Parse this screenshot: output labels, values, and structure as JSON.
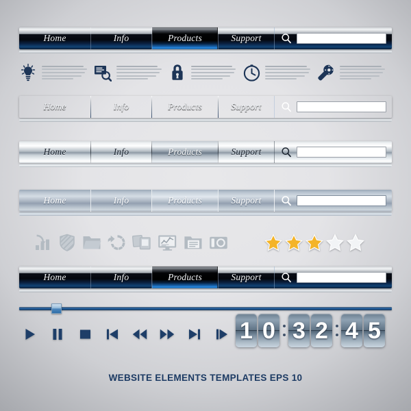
{
  "page": {
    "background_color": "#e7e7e9",
    "vignette_edge_color": "#a7a9ae",
    "caption": "WEBSITE ELEMENTS TEMPLATES EPS 10",
    "caption_color": "#1c3a63"
  },
  "navbars": [
    {
      "id": "navbar-dark-1",
      "style": "glossy-black-blue",
      "tabs": [
        {
          "label": "Home",
          "active": false
        },
        {
          "label": "Info",
          "active": false
        },
        {
          "label": "Products",
          "active": true
        },
        {
          "label": "Support",
          "active": false
        }
      ],
      "search": {
        "icon": "search-icon",
        "value": "",
        "placeholder": ""
      },
      "accent_color": "#2f93e8",
      "has_underline": true
    },
    {
      "id": "navbar-dark-2",
      "style": "chrome-top-black-blue",
      "tabs": [
        {
          "label": "Home",
          "active": false
        },
        {
          "label": "Info",
          "active": false
        },
        {
          "label": "Products",
          "active": true
        },
        {
          "label": "Support",
          "active": false
        }
      ],
      "search": {
        "icon": "search-icon",
        "value": "",
        "placeholder": ""
      },
      "accent_color": "#3aa0ef",
      "has_underline": true
    },
    {
      "id": "navbar-silver-3",
      "style": "light-silver-chrome",
      "tabs": [
        {
          "label": "Home",
          "active": false
        },
        {
          "label": "Info",
          "active": false
        },
        {
          "label": "Products",
          "active": true
        },
        {
          "label": "Support",
          "active": false
        }
      ],
      "search": {
        "icon": "search-icon",
        "value": "",
        "placeholder": ""
      },
      "accent_color": "#8e9aa5",
      "has_underline": true
    },
    {
      "id": "navbar-bluegrey-4",
      "style": "soft-blue-grey",
      "tabs": [
        {
          "label": "Home",
          "active": false
        },
        {
          "label": "Info",
          "active": false
        },
        {
          "label": "Products",
          "active": true
        },
        {
          "label": "Support",
          "active": false
        }
      ],
      "search": {
        "icon": "search-icon",
        "value": "",
        "placeholder": ""
      },
      "accent_color": "#aab5c2",
      "has_underline": true
    },
    {
      "id": "navbar-dark-5",
      "style": "glossy-black-blue",
      "tabs": [
        {
          "label": "Home",
          "active": false
        },
        {
          "label": "Info",
          "active": false
        },
        {
          "label": "Products",
          "active": true
        },
        {
          "label": "Support",
          "active": false
        }
      ],
      "search": {
        "icon": "search-icon",
        "value": "",
        "placeholder": ""
      },
      "accent_color": "#2f93e8",
      "has_underline": true
    }
  ],
  "feature_row": {
    "items": [
      {
        "icon": "lightbulb-icon",
        "text_placeholder_lines": 5
      },
      {
        "icon": "document-search-icon",
        "text_placeholder_lines": 5
      },
      {
        "icon": "lock-icon",
        "text_placeholder_lines": 5
      },
      {
        "icon": "clock-icon",
        "text_placeholder_lines": 5
      },
      {
        "icon": "wrench-gear-icon",
        "text_placeholder_lines": 5
      }
    ],
    "icon_color": "#1d3557",
    "line_color": "#b9bec4"
  },
  "grey_icon_strip": {
    "icon_color": "#b3bbc2",
    "icons": [
      "bar-chart-arrow-icon",
      "shield-striped-icon",
      "folder-icon",
      "pie-chart-refresh-icon",
      "photos-stack-icon",
      "monitor-line-chart-icon",
      "folder-documents-icon",
      "camera-icon"
    ]
  },
  "rating": {
    "label": "star-rating",
    "value": 3,
    "max": 5,
    "filled_color": "#f4b428",
    "empty_color": "#f2f4f6"
  },
  "player": {
    "slider": {
      "value_percent": 10,
      "track_color": "#2f6fae",
      "handle_color": "#9dc0dd"
    },
    "buttons": [
      {
        "name": "play-button",
        "icon": "play-icon"
      },
      {
        "name": "pause-button",
        "icon": "pause-icon"
      },
      {
        "name": "stop-button",
        "icon": "stop-icon"
      },
      {
        "name": "previous-track-button",
        "icon": "previous-track-icon"
      },
      {
        "name": "rewind-button",
        "icon": "rewind-icon"
      },
      {
        "name": "fast-forward-button",
        "icon": "fast-forward-icon"
      },
      {
        "name": "next-track-button",
        "icon": "next-track-icon"
      },
      {
        "name": "step-forward-button",
        "icon": "step-forward-icon"
      }
    ],
    "button_color": "#1e3e68"
  },
  "flip_clock": {
    "time": "10:32:45",
    "hours": [
      "1",
      "0"
    ],
    "minutes": [
      "3",
      "2"
    ],
    "seconds": [
      "4",
      "5"
    ],
    "separator": ":",
    "digit_color": "#ffffff",
    "card_color": "#6d7f90"
  }
}
